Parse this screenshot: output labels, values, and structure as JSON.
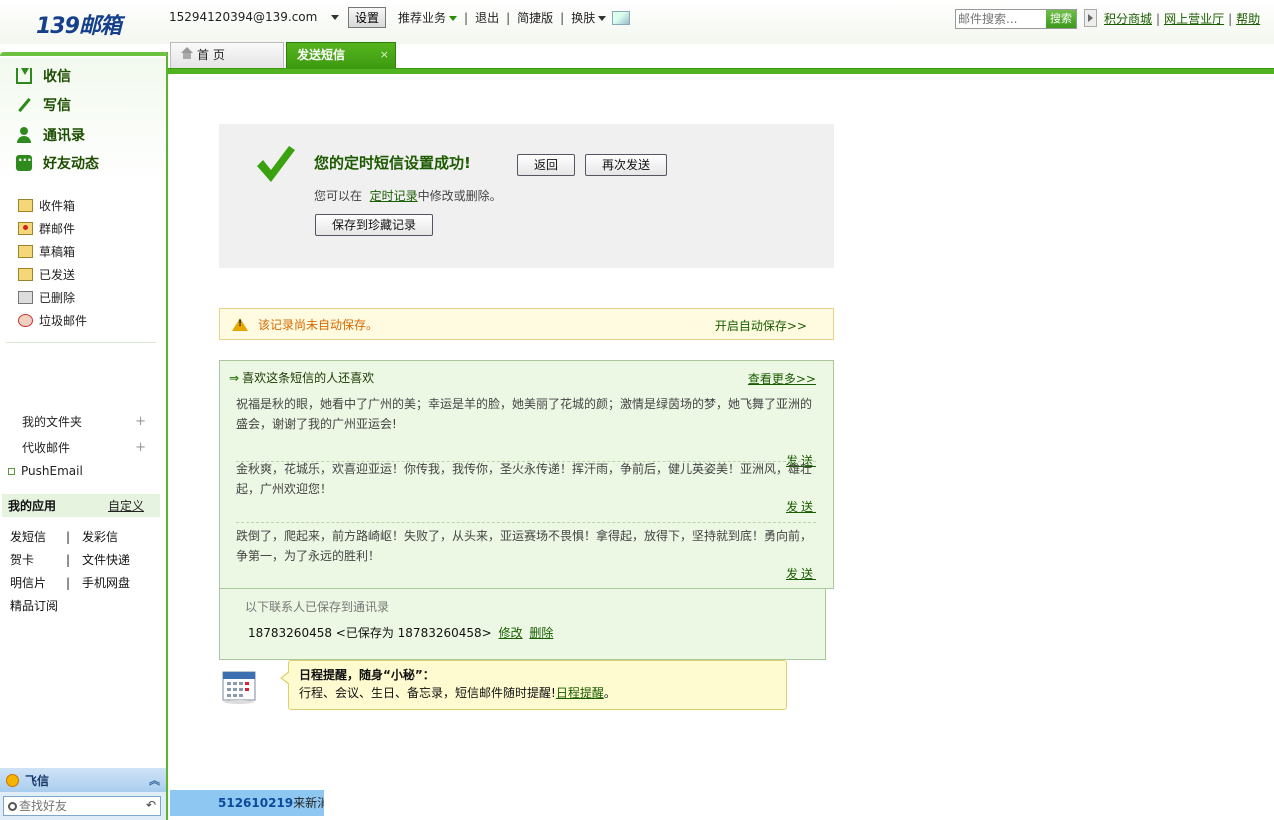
{
  "header": {
    "logo_text": "139邮箱",
    "account": "15294120394@139.com",
    "settings_label": "设置",
    "nav": [
      "推荐业务",
      "退出",
      "简捷版",
      "换肤"
    ],
    "search_placeholder": "邮件搜索...",
    "search_button": "搜索",
    "links": [
      "积分商城",
      "网上营业厅",
      "帮助"
    ]
  },
  "tabs": {
    "home": "首 页",
    "active": "发送短信",
    "close": "×"
  },
  "sidebar": {
    "main_nav": [
      "收信",
      "写信",
      "通讯录",
      "好友动态"
    ],
    "folders": [
      "收件箱",
      "群邮件",
      "草稿箱",
      "已发送",
      "已删除",
      "垃圾邮件"
    ],
    "my_folders": "我的文件夹",
    "proxy_mail": "代收邮件",
    "push_email": "PushEmail",
    "apps_title": "我的应用",
    "apps_customize": "自定义",
    "apps": [
      [
        "发短信",
        "发彩信"
      ],
      [
        "贺卡",
        "文件快递"
      ],
      [
        "明信片",
        "手机网盘"
      ],
      [
        "精品订阅",
        ""
      ]
    ],
    "feixin": {
      "title": "飞信",
      "search_placeholder": "查找好友"
    }
  },
  "ticker": {
    "number": "512610219",
    "text": "来新消息"
  },
  "success": {
    "title": "您的定时短信设置成功!",
    "back_button": "返回",
    "resend_button": "再次发送",
    "hint_prefix": "您可以在",
    "hint_link": "定时记录",
    "hint_suffix": "中修改或删除。",
    "save_button": "保存到珍藏记录"
  },
  "warning": {
    "message": "该记录尚未自动保存。",
    "action": "开启自动保存>>"
  },
  "recommend": {
    "title": "喜欢这条短信的人还喜欢",
    "more": "查看更多>>",
    "send_label": "发送",
    "items": [
      "祝福是秋的眼，她看中了广州的美；幸运是羊的脸，她美丽了花城的颜；激情是绿茵场的梦，她飞舞了亚洲的盛会，谢谢了我的广州亚运会!",
      "金秋爽，花城乐，欢喜迎亚运！你传我，我传你，圣火永传递！挥汗雨，争前后，健儿英姿美！亚洲风，雄壮起，广州欢迎您！",
      "跌倒了，爬起来，前方路崎岖！失败了，从头来，亚运赛场不畏惧！拿得起，放得下，坚持就到底！勇向前，争第一，为了永远的胜利！"
    ]
  },
  "contacts": {
    "label": "以下联系人已保存到通讯录",
    "entry": "18783260458 <已保存为 18783260458>",
    "edit": "修改",
    "delete": "删除"
  },
  "reminder": {
    "title": "日程提醒，随身“小秘”：",
    "desc": "行程、会议、生日、备忘录，短信邮件随时提醒!",
    "link": "日程提醒",
    "end": "。"
  }
}
